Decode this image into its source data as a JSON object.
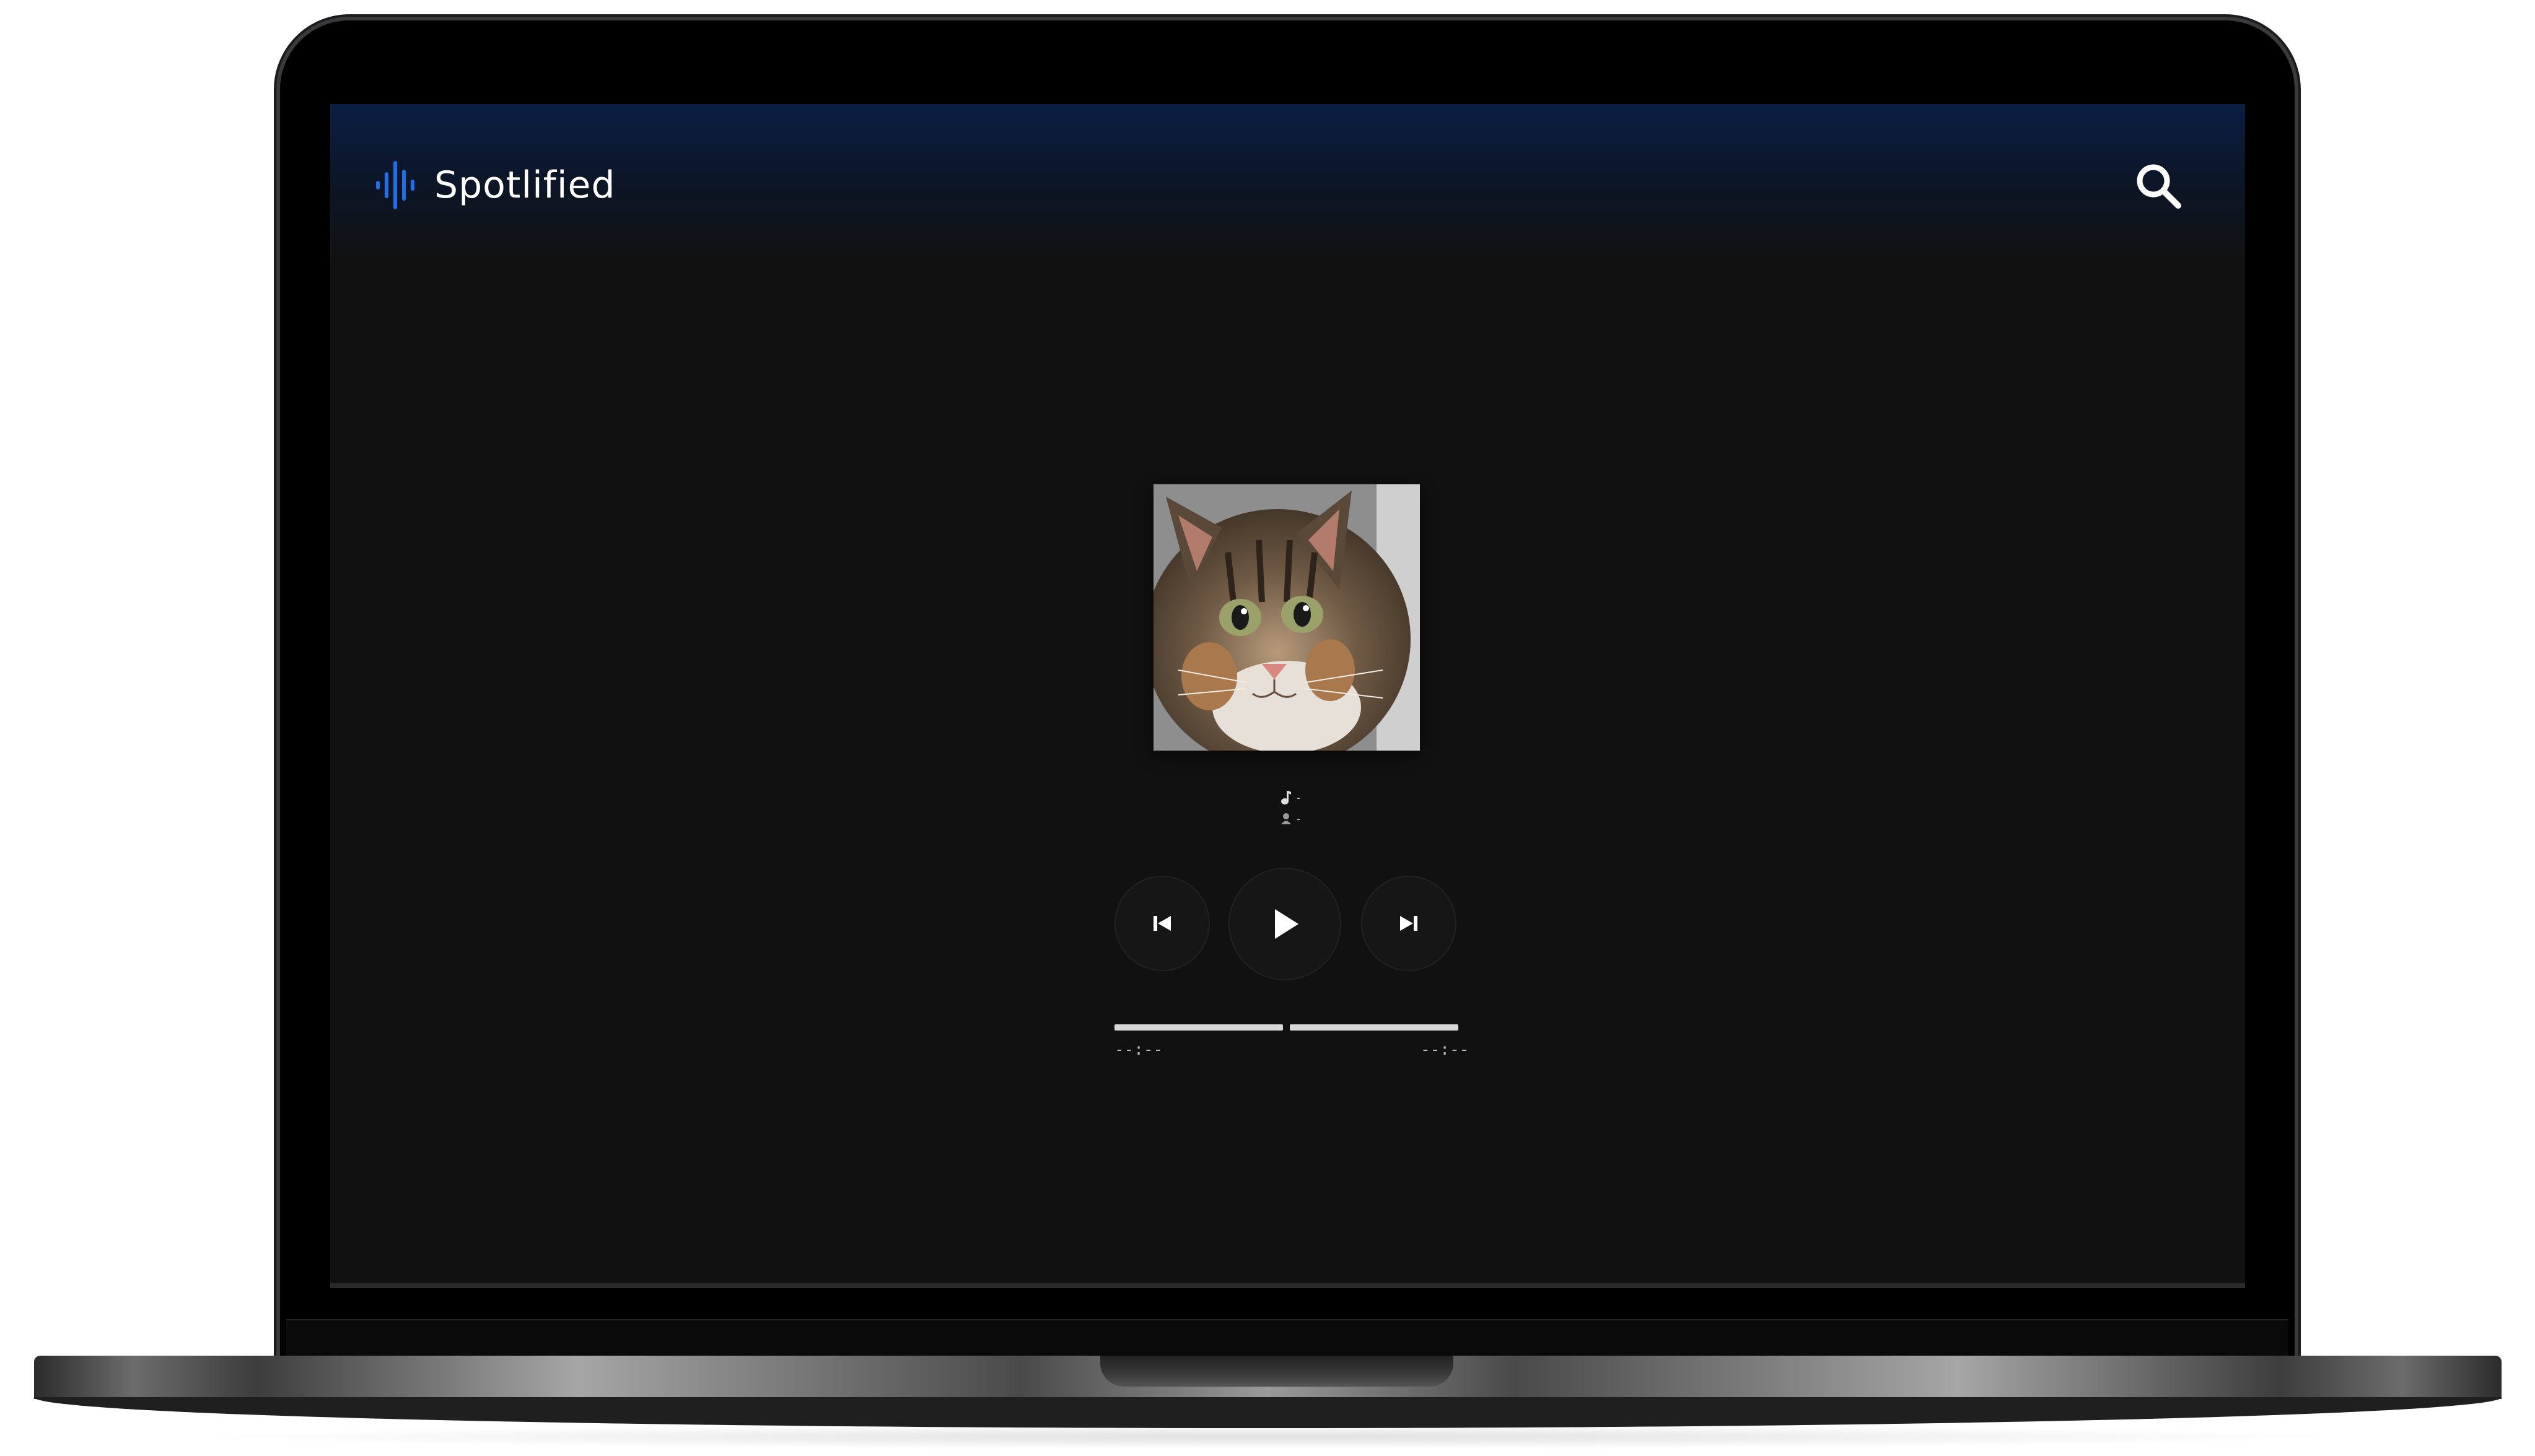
{
  "app": {
    "name": "Spotlified"
  },
  "header": {
    "logo_icon": "waveform-icon",
    "search_icon": "search-icon"
  },
  "player": {
    "cover_alt": "album cover",
    "track_title": "-",
    "track_artist": "-",
    "prev_icon": "skip-previous-icon",
    "play_icon": "play-icon",
    "next_icon": "skip-next-icon",
    "time_current": "--:--",
    "time_total": "--:--"
  },
  "colors": {
    "accent": "#1f6feb",
    "background": "#111111",
    "header_top": "#0b1e42"
  }
}
